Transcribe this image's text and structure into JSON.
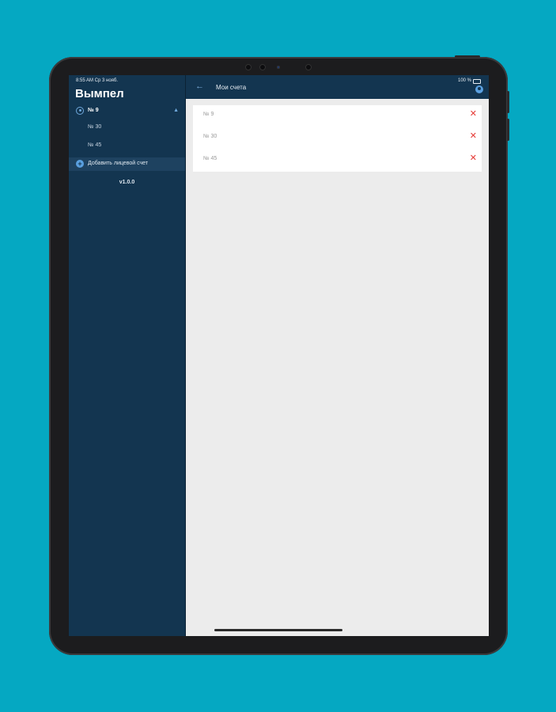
{
  "status": {
    "time_date": "8:55 AM  Ср 3 нояб.",
    "battery": "100 %"
  },
  "sidebar": {
    "app_title": "Вымпел",
    "current_account": "№ 9",
    "accounts": [
      "№ 30",
      "№ 45"
    ],
    "add_account_label": "Добавить лицевой счет",
    "version": "v1.0.0"
  },
  "topbar": {
    "title": "Мои счета"
  },
  "accounts_list": [
    {
      "number": "№ 9"
    },
    {
      "number": "№ 30"
    },
    {
      "number": "№ 45"
    }
  ],
  "icons": {
    "back": "arrow-left-icon",
    "close": "close-icon",
    "user": "user-icon",
    "chevron": "chevron-up-icon",
    "add": "plus-icon"
  },
  "colors": {
    "background": "#05a8c2",
    "sidebar": "#133550",
    "accent": "#5aa0e0",
    "delete": "#e53935"
  }
}
